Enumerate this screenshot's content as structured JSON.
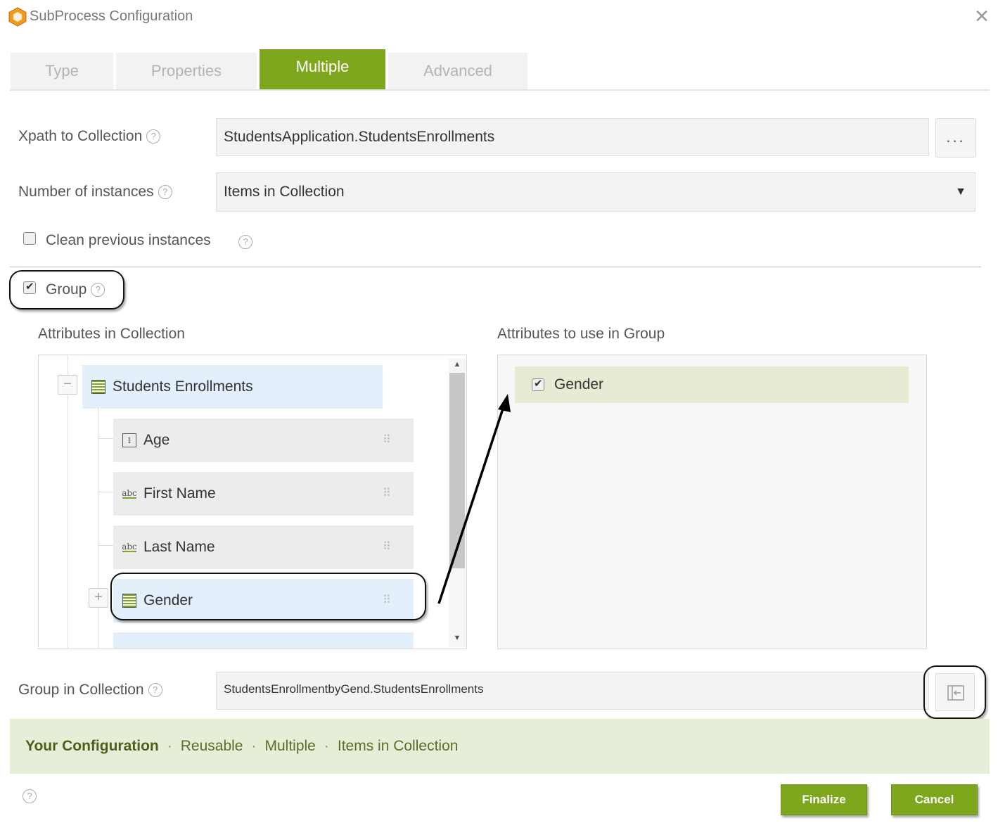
{
  "window": {
    "title": "SubProcess Configuration",
    "close_label": "✕"
  },
  "tabs": [
    "Type",
    "Properties",
    "Multiple",
    "Advanced"
  ],
  "active_tab": "Multiple",
  "form": {
    "xpath_label": "Xpath to Collection",
    "xpath_value": "StudentsApplication.StudentsEnrollments",
    "browse_label": "...",
    "instances_label": "Number of instances",
    "instances_value": "Items in Collection",
    "clean_label": "Clean previous instances",
    "clean_checked": false,
    "group_label": "Group",
    "group_checked": true
  },
  "attributes_in_collection": {
    "title": "Attributes in Collection",
    "root": "Students Enrollments",
    "items": [
      {
        "label": "Age",
        "icon": "number-icon"
      },
      {
        "label": "First Name",
        "icon": "text-icon"
      },
      {
        "label": "Last Name",
        "icon": "text-icon"
      },
      {
        "label": "Gender",
        "icon": "entity-icon"
      }
    ]
  },
  "attributes_in_group": {
    "title": "Attributes to use in Group",
    "items": [
      {
        "label": "Gender",
        "checked": true
      }
    ]
  },
  "group_in_collection": {
    "label": "Group in Collection",
    "value": "StudentsEnrollmentbyGend.StudentsEnrollments"
  },
  "your_configuration": {
    "title": "Your Configuration",
    "items": [
      "Reusable",
      "Multiple",
      "Items in Collection"
    ]
  },
  "footer": {
    "finalize_label": "Finalize",
    "cancel_label": "Cancel"
  },
  "colors": {
    "accent": "#7ea71e",
    "selection": "#e3effb",
    "config_bar": "#e7eed8"
  }
}
